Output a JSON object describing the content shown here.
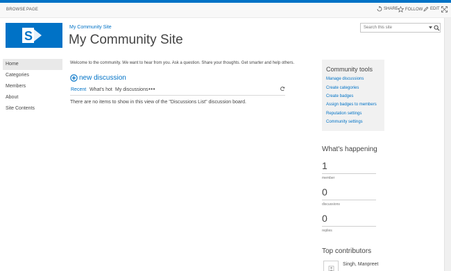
{
  "ribbon": {
    "tabs": [
      "BROWSE",
      "PAGE"
    ],
    "actions": [
      {
        "label": "SHARE",
        "icon": "share-icon"
      },
      {
        "label": "FOLLOW",
        "icon": "star-icon"
      },
      {
        "label": "EDIT",
        "icon": "pencil-icon"
      }
    ],
    "focus_icon": "focus-mode-icon"
  },
  "site": {
    "breadcrumb": "My Community Site",
    "title": "My Community Site",
    "logo_icon": "sharepoint-logo-icon"
  },
  "search": {
    "placeholder": "Search this site"
  },
  "left_nav": {
    "items": [
      "Home",
      "Categories",
      "Members",
      "About",
      "Site Contents"
    ],
    "selected": "Home"
  },
  "main": {
    "welcome": "Welcome to the community. We want to hear from you. Ask a question. Share your thoughts. Get smarter and help others.",
    "new_discussion": "new discussion",
    "views": [
      "Recent",
      "What's hot",
      "My discussions"
    ],
    "selected_view": "Recent",
    "more": "•••",
    "empty_message": "There are no items to show in this view of the \"Discussions List\" discussion board."
  },
  "community_tools": {
    "heading": "Community tools",
    "links": [
      "Manage discussions",
      "Create categories",
      "Create badges",
      "Assign badges to members",
      "Reputation settings",
      "Community settings"
    ]
  },
  "whats_happening": {
    "heading": "What's happening",
    "stats": [
      {
        "value": "1",
        "label": "member"
      },
      {
        "value": "0",
        "label": "discussions"
      },
      {
        "value": "0",
        "label": "replies"
      }
    ]
  },
  "top_contributors": {
    "heading": "Top contributors",
    "items": [
      {
        "name": "Singh, Manpreet"
      }
    ]
  },
  "colors": {
    "accent": "#0072c6",
    "tools_bg": "#f1f1f1",
    "selected_nav_bg": "#e9e9e9"
  }
}
